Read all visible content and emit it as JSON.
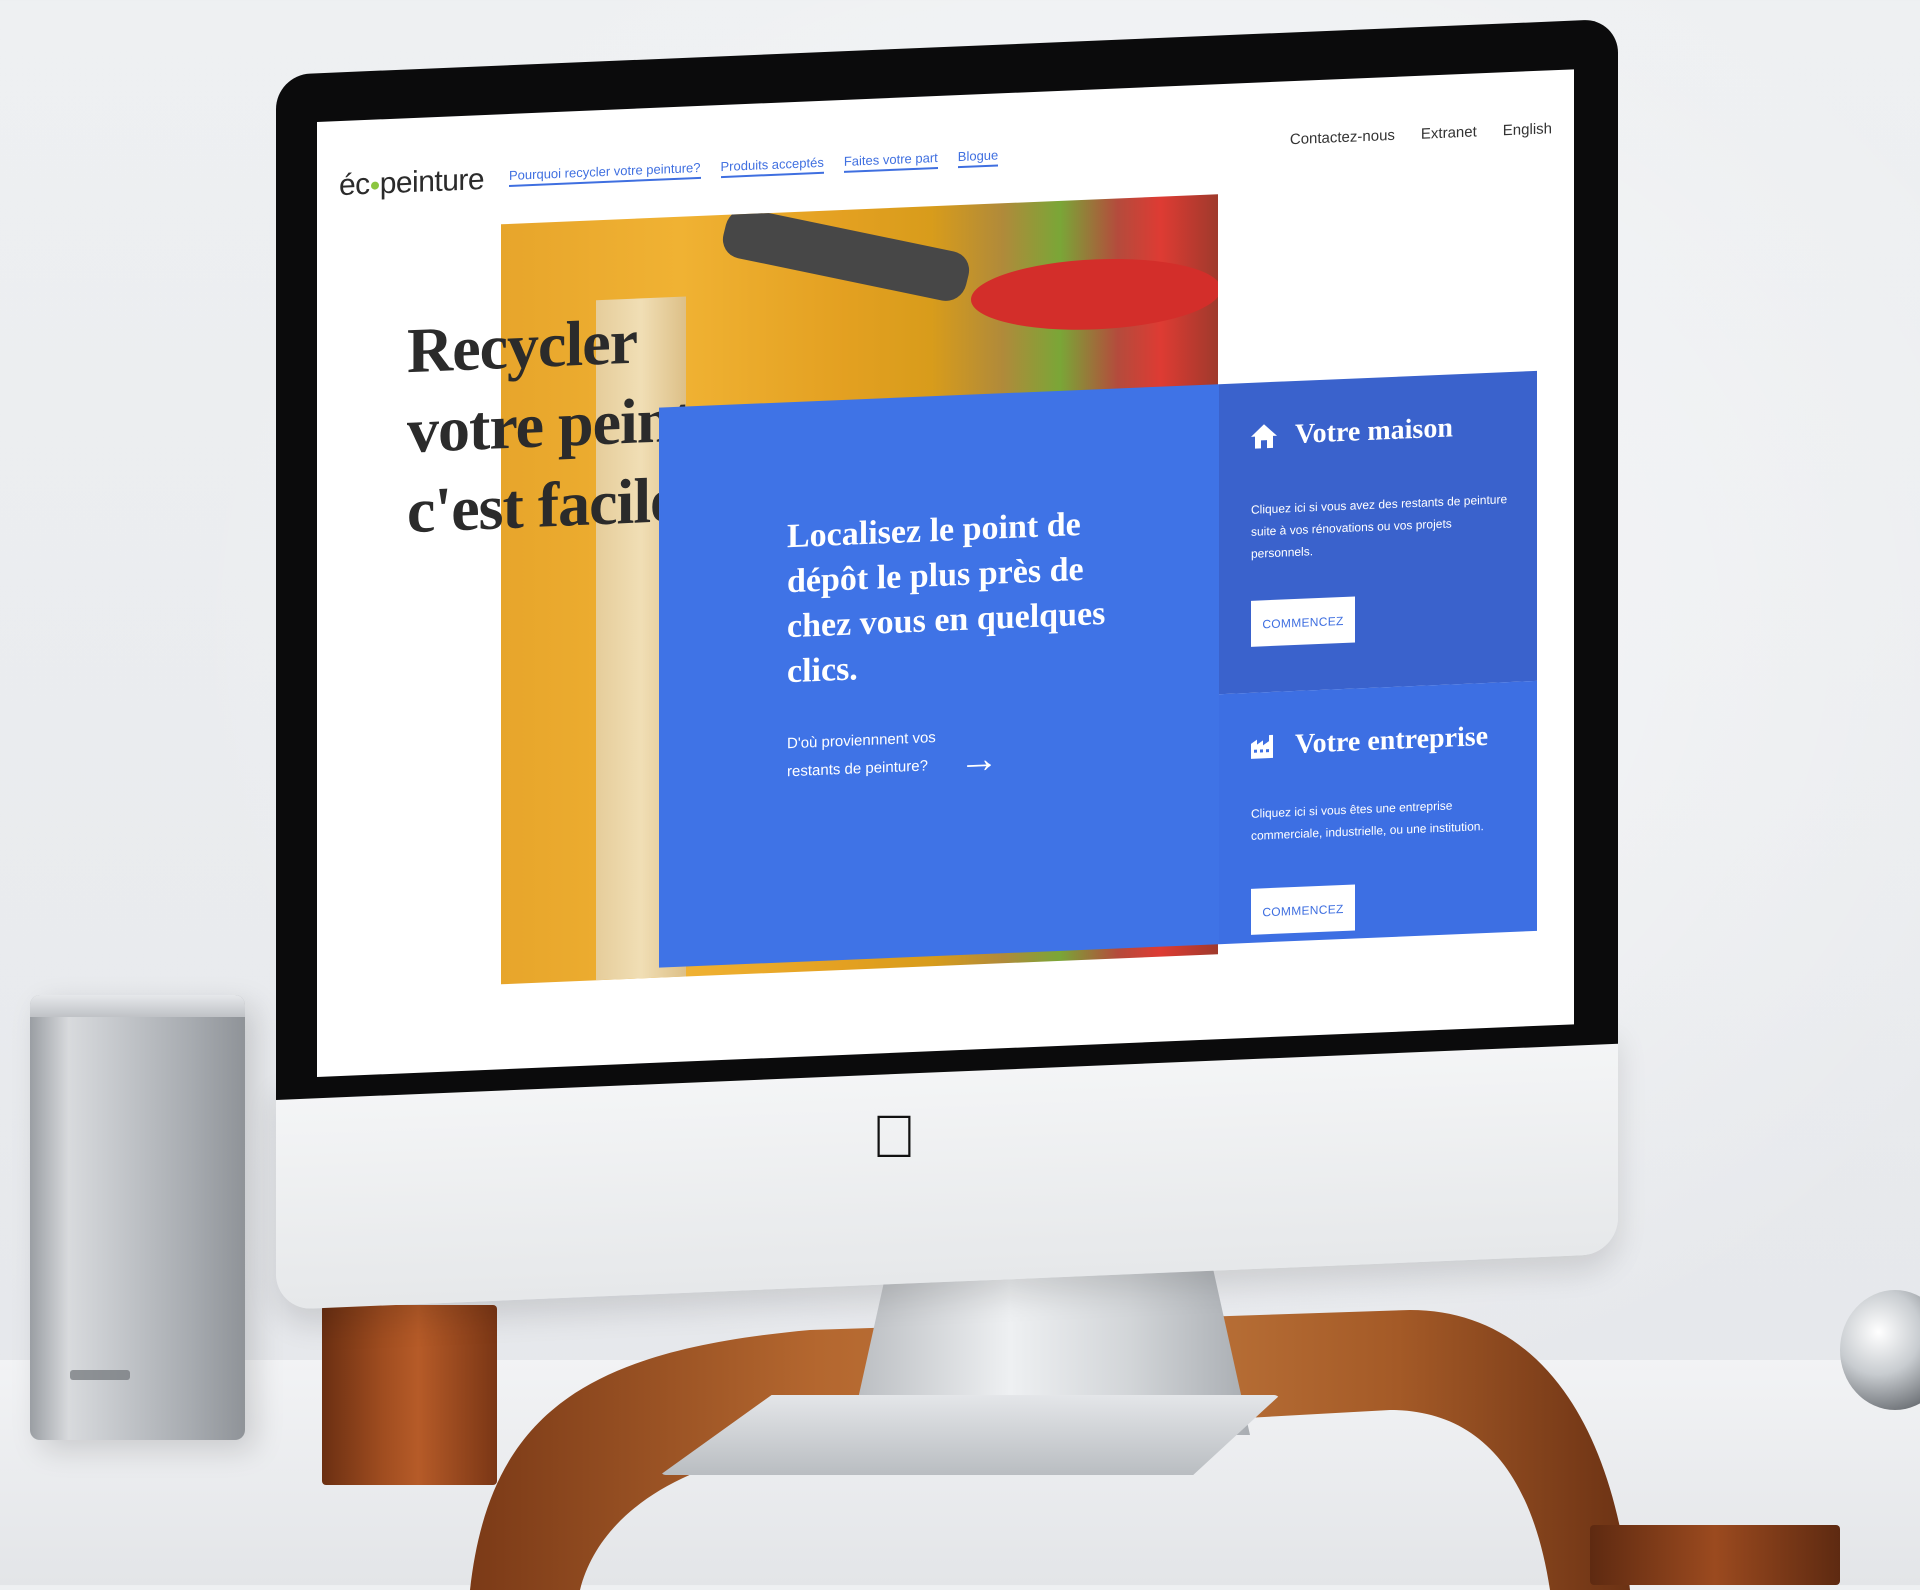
{
  "site": {
    "logo_text_left": "éc",
    "logo_text_right": "peinture",
    "brand_green": "#8cc63f",
    "accent_blue": "#3f6fe0"
  },
  "nav": {
    "main": [
      {
        "label": "Pourquoi recycler votre peinture?"
      },
      {
        "label": "Produits acceptés"
      },
      {
        "label": "Faites votre part"
      },
      {
        "label": "Blogue"
      }
    ],
    "utility": [
      {
        "label": "Contactez-nous"
      },
      {
        "label": "Extranet"
      },
      {
        "label": "English"
      }
    ]
  },
  "hero": {
    "title_lines": [
      "Recycler",
      "votre peinture,",
      "c'est facile."
    ],
    "cta_title": "Localisez le point de dépôt le plus près de chez vous en quelques clics.",
    "cta_sub": "D'où proviennnent vos restants de peinture?",
    "cta_arrow_icon": "arrow-right-icon"
  },
  "cards": [
    {
      "icon": "house-icon",
      "title": "Votre maison",
      "text": "Cliquez ici si vous avez des restants de peinture suite à vos rénovations ou vos projets personnels.",
      "button": "COMMENCEZ",
      "color": "#3a62cc"
    },
    {
      "icon": "factory-icon",
      "title": "Votre entreprise",
      "text": "Cliquez ici si vous êtes une entreprise commerciale, industrielle, ou une institution.",
      "button": "COMMENCEZ",
      "color": "#3d6fe3"
    }
  ]
}
